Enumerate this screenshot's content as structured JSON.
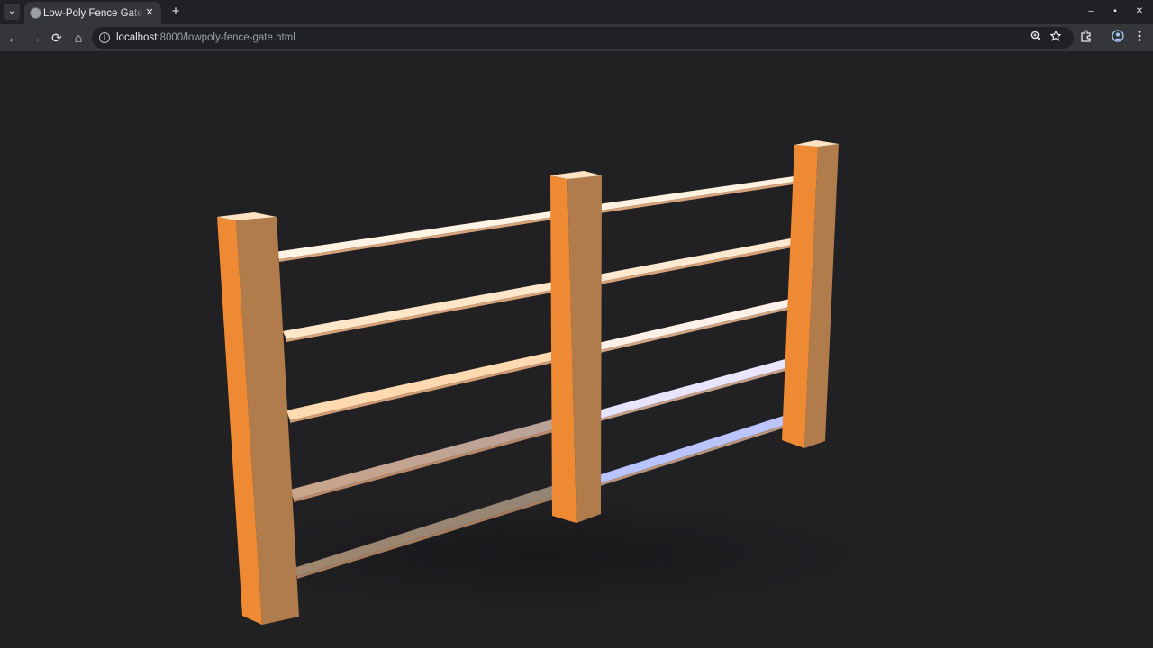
{
  "browser": {
    "tab": {
      "title": "Low-Poly Fence Gate in Three.js",
      "favicon": "globe-icon",
      "close": "✕"
    },
    "new_tab": "+",
    "tab_menu": "⌄",
    "window_controls": {
      "minimize": "–",
      "maximize": "▪",
      "close": "✕"
    },
    "nav": {
      "back": "←",
      "forward": "→",
      "reload": "⟳",
      "home": "⌂"
    },
    "omnibox": {
      "info": "i",
      "url_host": "localhost",
      "url_rest": ":8000/lowpoly-fence-gate.html"
    },
    "icons": {
      "zoom": "zoom-icon",
      "bookmark": "star-icon",
      "extensions": "puzzle-icon",
      "profile": "profile-icon",
      "menu": "kebab-menu-icon"
    }
  },
  "scene": {
    "background": "#212023",
    "post_colors": {
      "front": "#ee8a33",
      "side": "#b07c4b",
      "top": "#ffe2c0"
    },
    "rail_colors": [
      "#fff3e4",
      "#ffe6c8",
      "#ffd9b0",
      "#caa48a",
      "#a58a76"
    ],
    "right_rail_colors": [
      "#fff1df",
      "#ffe8d0",
      "#fff0e8",
      "#e9e2ff",
      "#bfc8ff"
    ]
  }
}
